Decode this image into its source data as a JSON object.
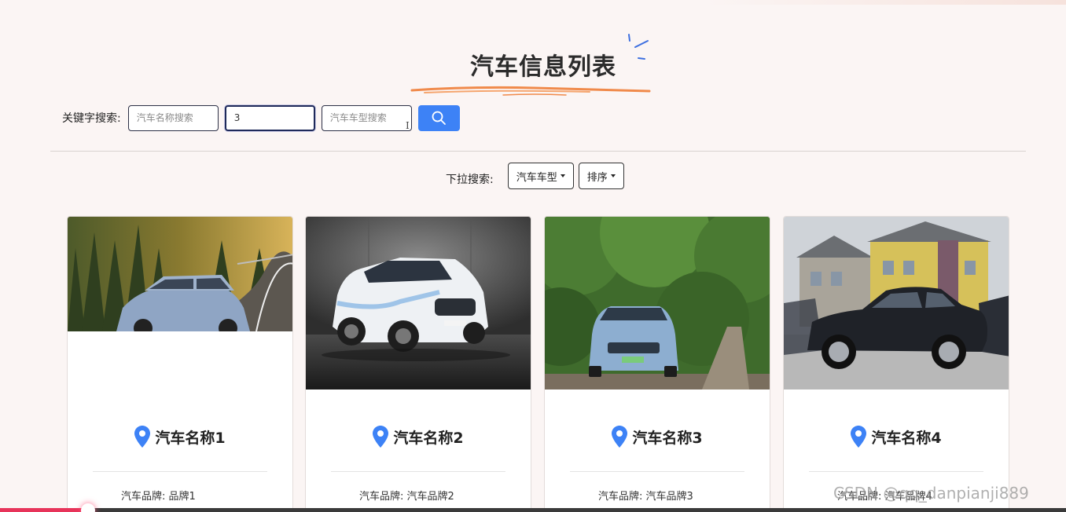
{
  "page": {
    "title": "汽车信息列表"
  },
  "search": {
    "label": "关键字搜索:",
    "name_placeholder": "汽车名称搜索",
    "brand_value": "3",
    "model_placeholder": "汽车车型搜索",
    "button_icon": "search-icon"
  },
  "dropdowns": {
    "label": "下拉搜索:",
    "model_label": "汽车车型",
    "sort_label": "排序"
  },
  "cars": [
    {
      "name": "汽车名称1",
      "brand_text": "汽车品牌: 品牌1"
    },
    {
      "name": "汽车名称2",
      "brand_text": "汽车品牌: 汽车品牌2"
    },
    {
      "name": "汽车名称3",
      "brand_text": "汽车品牌: 汽车品牌3"
    },
    {
      "name": "汽车名称4",
      "brand_text": "汽车品牌: 汽车品牌4"
    }
  ],
  "watermark": "CSDN @qq_danpianji889",
  "video_progress": 0.08,
  "colors": {
    "accent": "#3d82f6",
    "pin": "#3d82f6",
    "brush": "#f08a4b",
    "background": "#fbf5f4"
  }
}
